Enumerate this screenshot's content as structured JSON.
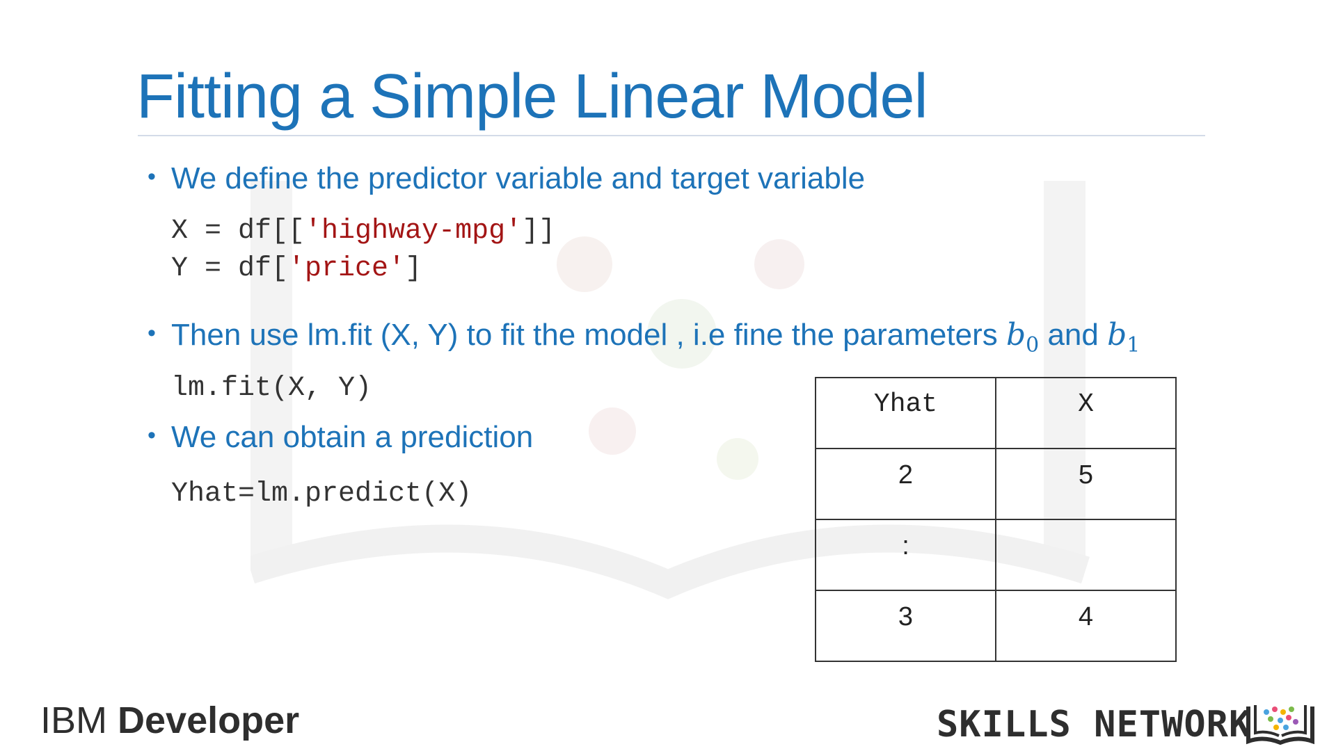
{
  "slide": {
    "title": "Fitting a Simple Linear Model",
    "bullets": [
      {
        "text": "We define the predictor variable and target variable"
      },
      {
        "text_before": "Then use lm.fit (X, Y) to fit the model , i.e fine the parameters ",
        "var1": "b",
        "sub1": "0",
        "text_mid": " and ",
        "var2": "b",
        "sub2": "1"
      },
      {
        "text": "We can obtain a prediction"
      }
    ],
    "code": {
      "line1_prefix": "X = df[[",
      "line1_string": "'highway-mpg'",
      "line1_suffix": "]]",
      "line2_prefix": "Y = df[",
      "line2_string": "'price'",
      "line2_suffix": "]",
      "fit_line": "lm.fit(X, Y)",
      "predict_line": "Yhat=lm.predict(X)"
    },
    "table": {
      "headers": [
        "Yhat",
        "X"
      ],
      "rows": [
        [
          "2",
          "5"
        ],
        [
          ":",
          ""
        ],
        [
          "3",
          "4"
        ]
      ]
    }
  },
  "footer": {
    "brand_left_1": "IBM",
    "brand_left_2": "Developer",
    "brand_right": "SKILLS NETWORK"
  },
  "colors": {
    "title": "#1d73b8",
    "bullet": "#1d73b8",
    "code_string": "#a31515",
    "code_text": "#333333"
  }
}
